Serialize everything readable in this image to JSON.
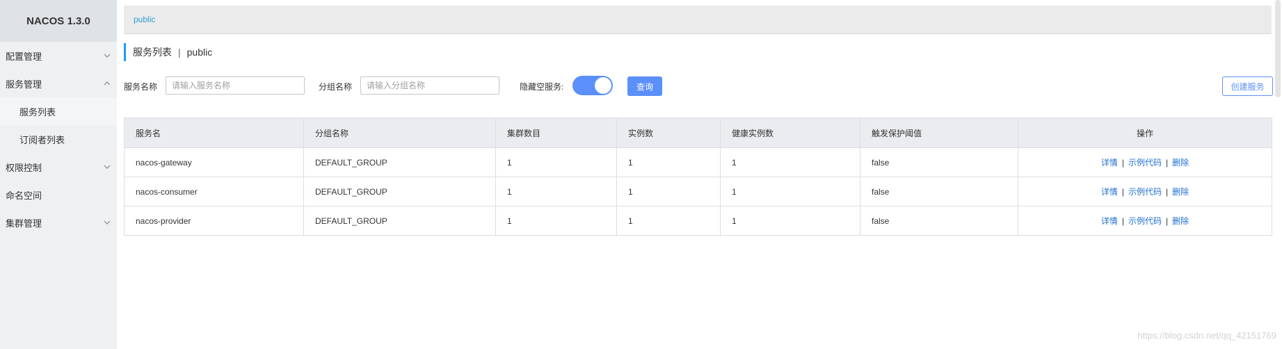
{
  "app": {
    "brand": "NACOS 1.3.0"
  },
  "sidebar": {
    "items": [
      {
        "label": "配置管理",
        "chevron": "down"
      },
      {
        "label": "服务管理",
        "chevron": "up"
      },
      {
        "label": "权限控制",
        "chevron": "down"
      },
      {
        "label": "命名空间"
      },
      {
        "label": "集群管理",
        "chevron": "down"
      }
    ],
    "sub_items": [
      {
        "label": "服务列表",
        "active": true
      },
      {
        "label": "订阅者列表"
      }
    ]
  },
  "topbar": {
    "namespace": "public"
  },
  "page": {
    "title": "服务列表",
    "separator": "|",
    "namespace": "public"
  },
  "filters": {
    "service_name_label": "服务名称",
    "service_name_placeholder": "请输入服务名称",
    "group_name_label": "分组名称",
    "group_name_placeholder": "请输入分组名称",
    "hide_empty_label": "隐藏空服务:",
    "hide_empty_on": true,
    "query_button": "查询",
    "create_button": "创建服务"
  },
  "table": {
    "headers": [
      "服务名",
      "分组名称",
      "集群数目",
      "实例数",
      "健康实例数",
      "触发保护阈值",
      "操作"
    ],
    "rows": [
      {
        "name": "nacos-gateway",
        "group": "DEFAULT_GROUP",
        "clusters": "1",
        "instances": "1",
        "healthy": "1",
        "threshold": "false"
      },
      {
        "name": "nacos-consumer",
        "group": "DEFAULT_GROUP",
        "clusters": "1",
        "instances": "1",
        "healthy": "1",
        "threshold": "false"
      },
      {
        "name": "nacos-provider",
        "group": "DEFAULT_GROUP",
        "clusters": "1",
        "instances": "1",
        "healthy": "1",
        "threshold": "false"
      }
    ],
    "actions": {
      "detail": "详情",
      "sample": "示例代码",
      "delete": "删除",
      "separator": "|"
    }
  },
  "watermark": "https://blog.csdn.net/qq_42151769",
  "colors": {
    "primary": "#5b8ff9",
    "link": "#1f6fd1",
    "accent": "#209bfa"
  }
}
